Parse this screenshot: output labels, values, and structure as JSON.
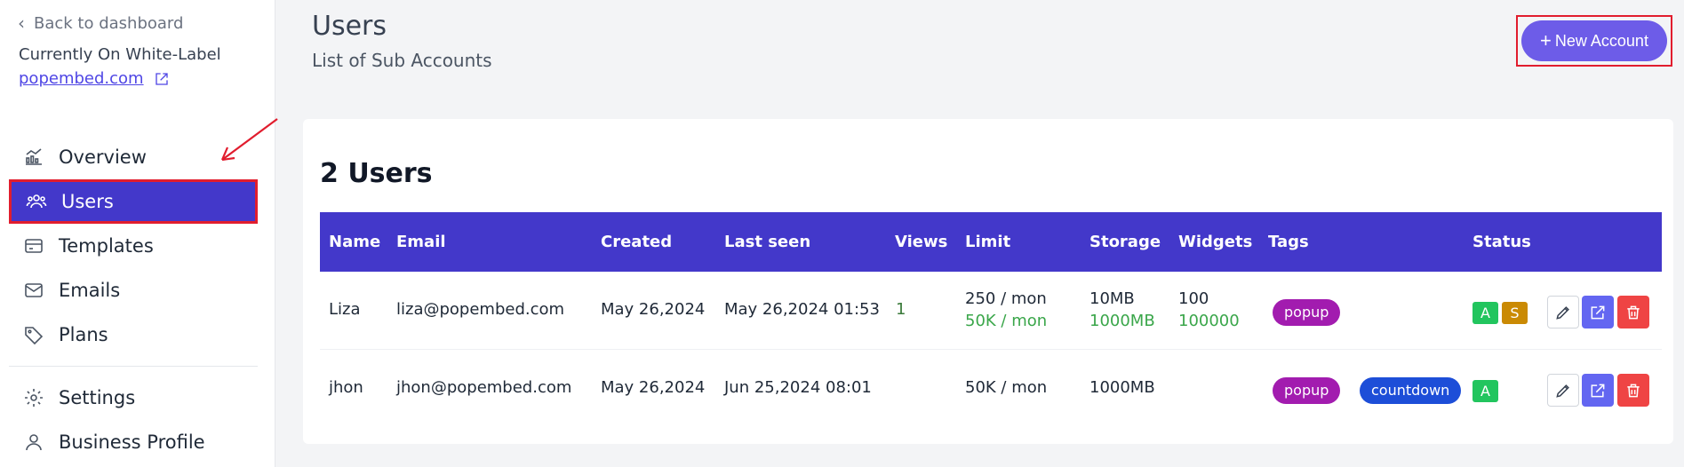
{
  "sidebar": {
    "back_label": "Back to dashboard",
    "white_label_text": "Currently On White-Label",
    "white_label_link": "popembed.com",
    "nav": [
      {
        "label": "Overview",
        "icon": "chart-icon"
      },
      {
        "label": "Users",
        "icon": "users-icon",
        "active": true
      },
      {
        "label": "Templates",
        "icon": "card-icon"
      },
      {
        "label": "Emails",
        "icon": "mail-icon"
      },
      {
        "label": "Plans",
        "icon": "tag-icon"
      },
      {
        "label": "Settings",
        "icon": "gear-icon"
      },
      {
        "label": "Business Profile",
        "icon": "user-icon"
      }
    ]
  },
  "header": {
    "title": "Users",
    "subtitle": "List of Sub Accounts",
    "new_button": "New Account"
  },
  "table": {
    "title": "2 Users",
    "columns": [
      "Name",
      "Email",
      "Created",
      "Last seen",
      "Views",
      "Limit",
      "Storage",
      "Widgets",
      "Tags",
      "Status"
    ],
    "rows": [
      {
        "name": "Liza",
        "email": "liza@popembed.com",
        "created": "May 26,2024",
        "last_seen": "May 26,2024 01:53",
        "views": "1",
        "limit_used": "250 / mon",
        "limit_total": "50K / mon",
        "storage_used": "10MB",
        "storage_total": "1000MB",
        "widgets_used": "100",
        "widgets_total": "100000",
        "tags": [
          "popup"
        ],
        "status": [
          "A",
          "S"
        ]
      },
      {
        "name": "jhon",
        "email": "jhon@popembed.com",
        "created": "May 26,2024",
        "last_seen": "Jun 25,2024 08:01",
        "views": "",
        "limit_total": "50K / mon",
        "storage_total": "1000MB",
        "tags": [
          "popup",
          "countdown"
        ],
        "status": [
          "A"
        ]
      }
    ]
  },
  "colors": {
    "accent": "#4338ca",
    "button": "#6d5ce8",
    "highlight_border": "#e11d2e"
  }
}
